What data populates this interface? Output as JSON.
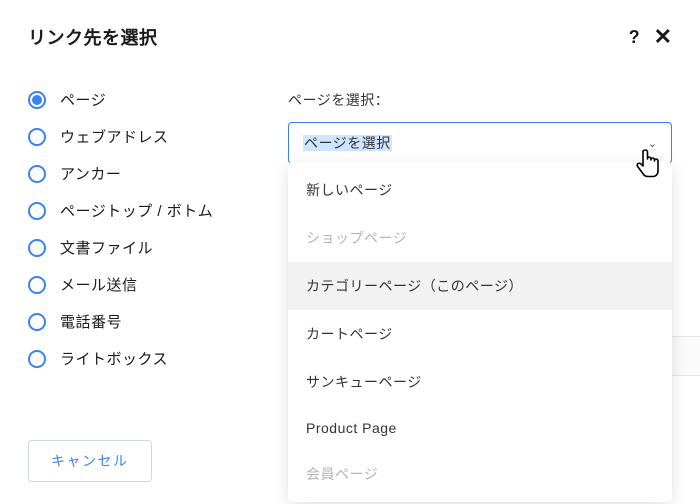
{
  "header": {
    "title": "リンク先を選択",
    "help": "?",
    "close": "✕"
  },
  "radios": {
    "items": [
      {
        "label": "ページ",
        "selected": true
      },
      {
        "label": "ウェブアドレス",
        "selected": false
      },
      {
        "label": "アンカー",
        "selected": false
      },
      {
        "label": "ページトップ / ボトム",
        "selected": false
      },
      {
        "label": "文書ファイル",
        "selected": false
      },
      {
        "label": "メール送信",
        "selected": false
      },
      {
        "label": "電話番号",
        "selected": false
      },
      {
        "label": "ライトボックス",
        "selected": false
      }
    ]
  },
  "select": {
    "field_label": "ページを選択：",
    "placeholder": "ページを選択",
    "chevron": "⌄"
  },
  "dropdown": {
    "items": [
      {
        "label": "新しいページ",
        "state": "normal"
      },
      {
        "label": "ショップページ",
        "state": "disabled"
      },
      {
        "label": "カテゴリーページ（このページ）",
        "state": "hover"
      },
      {
        "label": "カートページ",
        "state": "normal"
      },
      {
        "label": "サンキューページ",
        "state": "normal"
      },
      {
        "label": "Product Page",
        "state": "normal"
      },
      {
        "label": "会員ページ",
        "state": "disabled"
      }
    ]
  },
  "footer": {
    "cancel": "キャンセル"
  }
}
